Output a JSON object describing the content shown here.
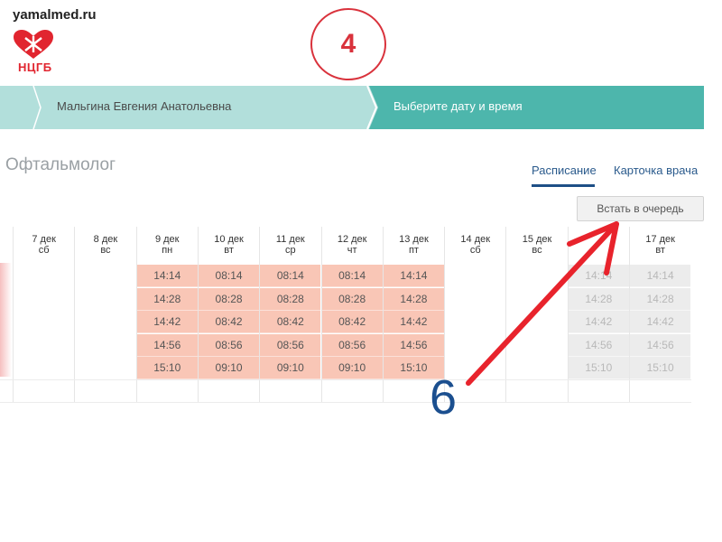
{
  "site": {
    "url": "yamalmed.ru",
    "logo_text": "НЦГБ"
  },
  "annotations": {
    "step_number": "4",
    "arrow_number": "6",
    "annotation_color": "#d9323c",
    "number_color": "#1b4f8f"
  },
  "colors": {
    "accent": "#4db6ac",
    "steps_light": "#b2dfdb",
    "slot_free": "#f9c6b6",
    "slot_inactive": "#ececec"
  },
  "steps": {
    "doctor": "Мальгина Евгения Анатольевна",
    "choose_datetime": "Выберите дату и время"
  },
  "specialty": "Офтальмолог",
  "tabs": {
    "schedule": "Расписание",
    "doctor_card": "Карточка врача"
  },
  "queue_button": "Встать в очередь",
  "days": [
    {
      "date": "7 дек",
      "weekday": "сб",
      "slots": []
    },
    {
      "date": "8 дек",
      "weekday": "вс",
      "slots": []
    },
    {
      "date": "9 дек",
      "weekday": "пн",
      "slots": [
        "14:14",
        "14:28",
        "14:42",
        "14:56",
        "15:10"
      ]
    },
    {
      "date": "10 дек",
      "weekday": "вт",
      "slots": [
        "08:14",
        "08:28",
        "08:42",
        "08:56",
        "09:10"
      ]
    },
    {
      "date": "11 дек",
      "weekday": "ср",
      "slots": [
        "08:14",
        "08:28",
        "08:42",
        "08:56",
        "09:10"
      ]
    },
    {
      "date": "12 дек",
      "weekday": "чт",
      "slots": [
        "08:14",
        "08:28",
        "08:42",
        "08:56",
        "09:10"
      ]
    },
    {
      "date": "13 дек",
      "weekday": "пт",
      "slots": [
        "14:14",
        "14:28",
        "14:42",
        "14:56",
        "15:10"
      ]
    },
    {
      "date": "14 дек",
      "weekday": "сб",
      "slots": []
    },
    {
      "date": "15 дек",
      "weekday": "вс",
      "slots": []
    },
    {
      "date": "",
      "weekday": "",
      "slots": [
        "14:14",
        "14:28",
        "14:42",
        "14:56",
        "15:10"
      ],
      "inactive": true
    },
    {
      "date": "17 дек",
      "weekday": "вт",
      "slots": [
        "14:14",
        "14:28",
        "14:42",
        "14:56",
        "15:10"
      ],
      "inactive": true
    }
  ]
}
